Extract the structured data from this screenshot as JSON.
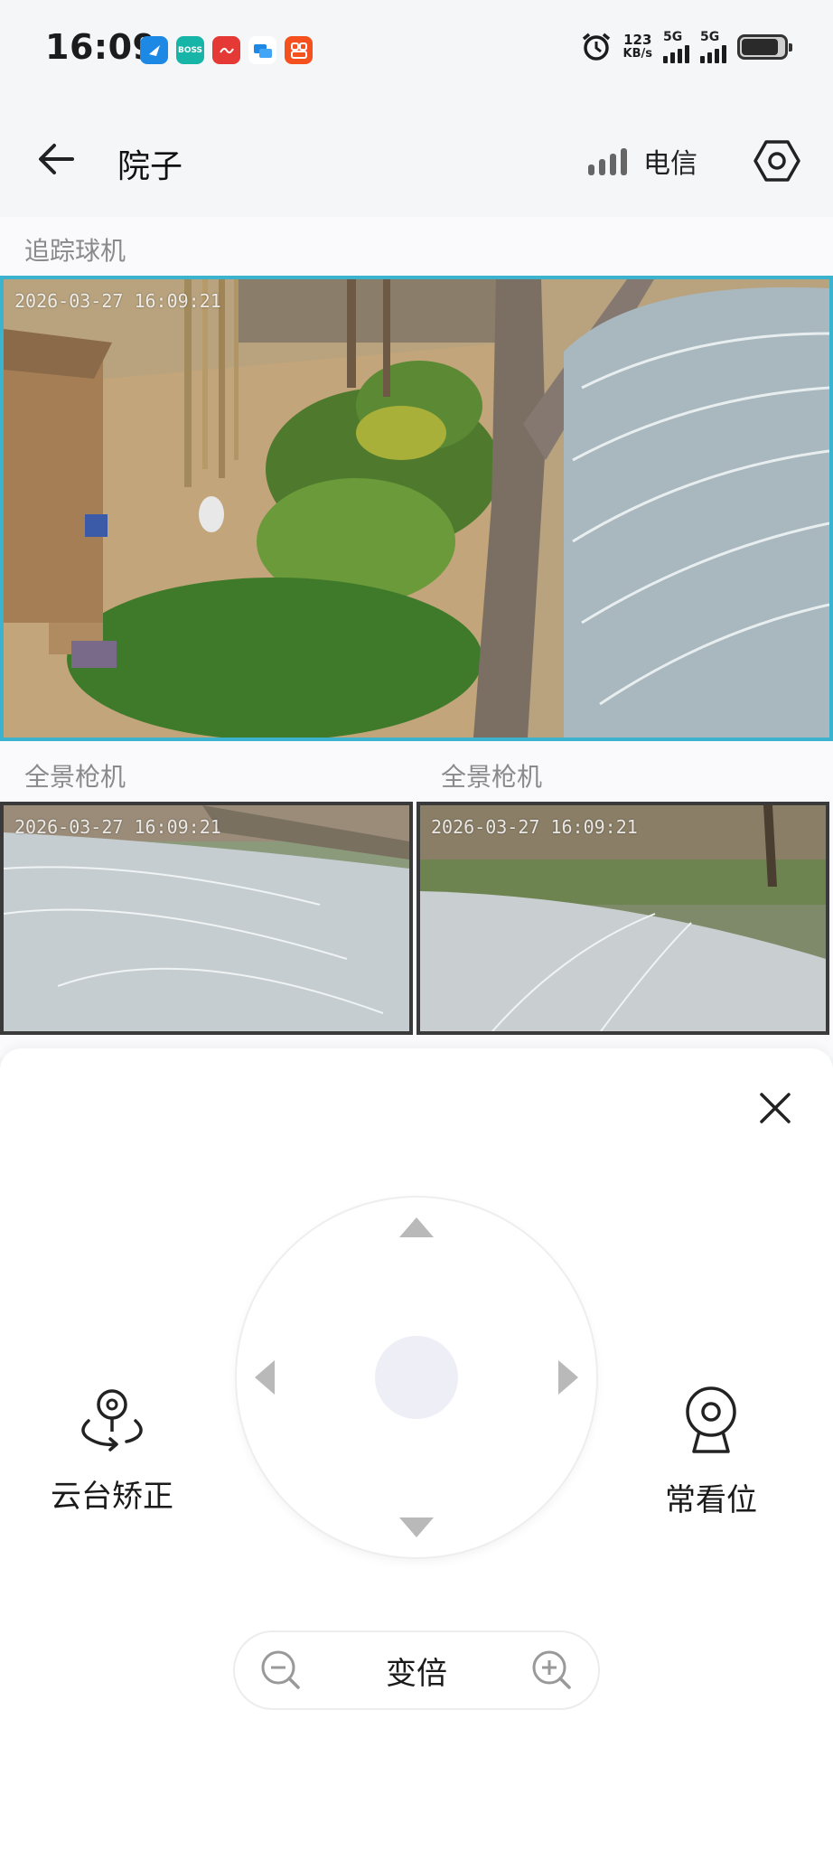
{
  "status_bar": {
    "time": "16:09",
    "app_icons": [
      {
        "name": "browser-app-icon",
        "color": "#1e88e5",
        "text": ""
      },
      {
        "name": "boss-zhipin-app-icon",
        "color": "#16b5a8",
        "text": "BOSS"
      },
      {
        "name": "red-app-icon",
        "color": "#e53935",
        "text": ""
      },
      {
        "name": "message-app-icon",
        "color": "#ffffff",
        "text": ""
      },
      {
        "name": "orange-app-icon",
        "color": "#f4511e",
        "text": ""
      }
    ],
    "net_speed_value": "123",
    "net_speed_unit": "KB/s",
    "network_1": "5G",
    "network_2": "5G",
    "battery_level": 0.75
  },
  "header": {
    "title": "院子",
    "carrier": "电信"
  },
  "cameras": {
    "main_label": "追踪球机",
    "main_timestamp": "2026-03-27 16:09:21",
    "sub": [
      {
        "label": "全景枪机",
        "timestamp": "2026-03-27 16:09:21"
      },
      {
        "label": "全景枪机",
        "timestamp": "2026-03-27 16:09:21"
      }
    ]
  },
  "controls": {
    "ptz_correct_label": "云台矫正",
    "preset_label": "常看位",
    "zoom_label": "变倍"
  },
  "colors": {
    "accent_border": "#3bb3cf",
    "dpad_center": "#eeeef6",
    "arrow": "#b9b9b9"
  }
}
